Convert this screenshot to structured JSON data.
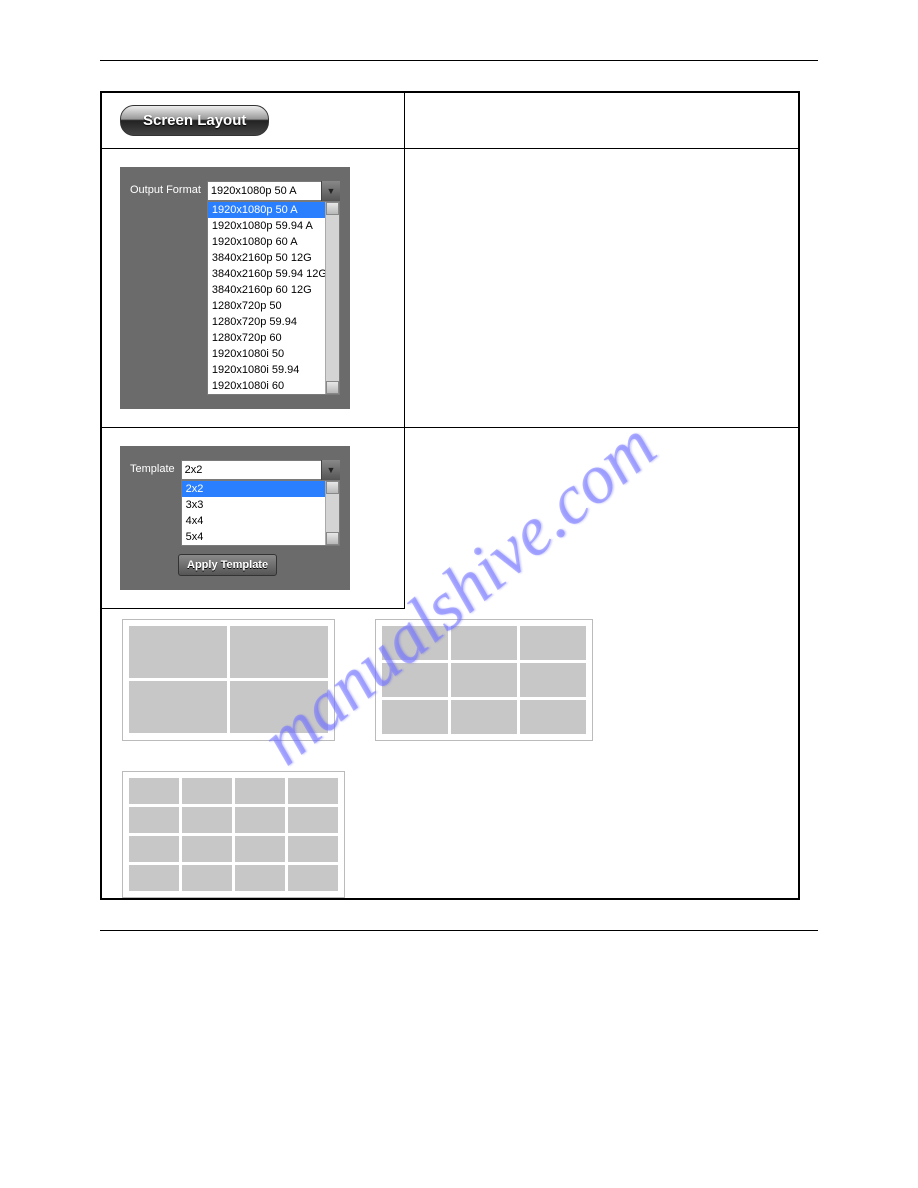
{
  "header_button": "Screen Layout",
  "output_format": {
    "label": "Output Format",
    "value": "1920x1080p 50 A",
    "options": [
      "1920x1080p 50 A",
      "1920x1080p 59.94 A",
      "1920x1080p 60 A",
      "3840x2160p 50 12G",
      "3840x2160p 59.94 12G",
      "3840x2160p 60 12G",
      "1280x720p 50",
      "1280x720p 59.94",
      "1280x720p 60",
      "1920x1080i 50",
      "1920x1080i 59.94",
      "1920x1080i 60"
    ]
  },
  "template": {
    "label": "Template",
    "value": "2x2",
    "options": [
      "2x2",
      "3x3",
      "4x4",
      "5x4"
    ],
    "apply_button": "Apply Template"
  },
  "watermark": "manualshive.com"
}
